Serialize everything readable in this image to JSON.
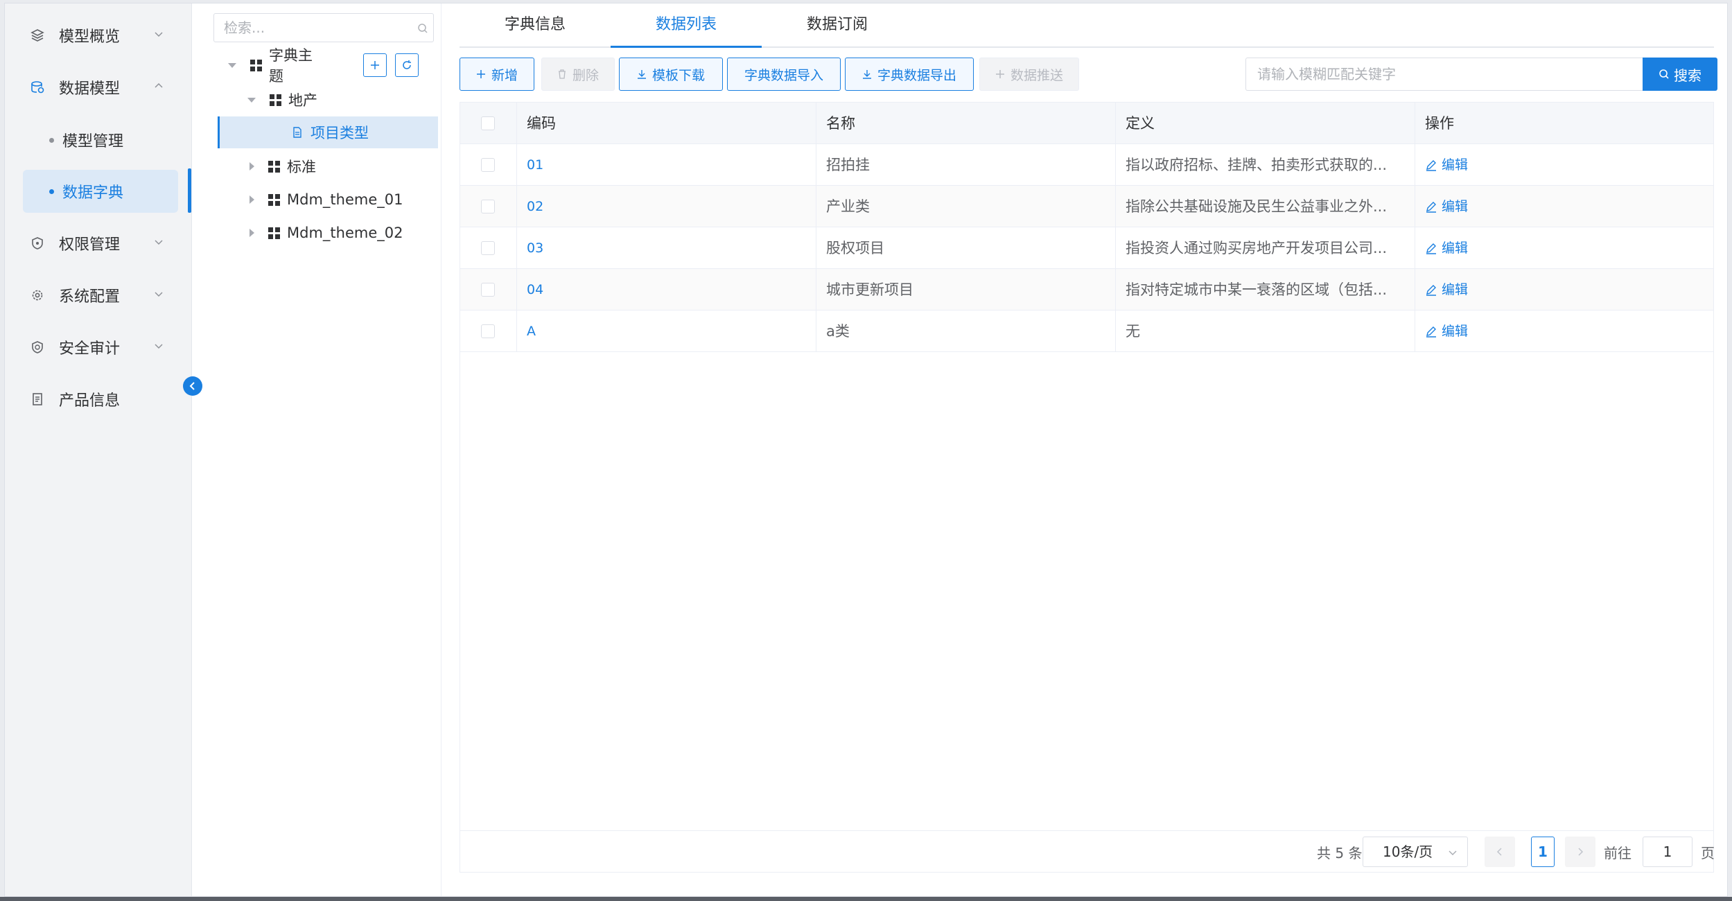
{
  "nav": {
    "items": [
      {
        "label": "模型概览",
        "icon": "layers-icon",
        "expanded": false
      },
      {
        "label": "数据模型",
        "icon": "database-icon",
        "expanded": true
      },
      {
        "label": "权限管理",
        "icon": "shield-icon",
        "expanded": false
      },
      {
        "label": "系统配置",
        "icon": "gear-icon",
        "expanded": false
      },
      {
        "label": "安全审计",
        "icon": "audit-shield-icon",
        "expanded": false
      },
      {
        "label": "产品信息",
        "icon": "document-icon"
      }
    ],
    "sub_items": [
      {
        "label": "模型管理",
        "active": false
      },
      {
        "label": "数据字典",
        "active": true
      }
    ]
  },
  "tree": {
    "search_placeholder": "检索...",
    "nodes": [
      {
        "label": "字典主题",
        "level": 0,
        "expanded": true
      },
      {
        "label": "地产",
        "level": 1,
        "expanded": true
      },
      {
        "label": "项目类型",
        "level": 2,
        "selected": true
      },
      {
        "label": "标准",
        "level": 1,
        "expanded": false
      },
      {
        "label": "Mdm_theme_01",
        "level": 1,
        "expanded": false
      },
      {
        "label": "Mdm_theme_02",
        "level": 1,
        "expanded": false
      }
    ]
  },
  "tabs": [
    {
      "label": "字典信息",
      "active": false
    },
    {
      "label": "数据列表",
      "active": true
    },
    {
      "label": "数据订阅",
      "active": false
    }
  ],
  "toolbar": {
    "add": "新增",
    "delete": "删除",
    "template_download": "模板下载",
    "import": "字典数据导入",
    "export": "字典数据导出",
    "push": "数据推送"
  },
  "search": {
    "placeholder": "请输入模糊匹配关键字",
    "button": "搜索"
  },
  "table": {
    "columns": [
      "编码",
      "名称",
      "定义",
      "操作"
    ],
    "rows": [
      {
        "code": "01",
        "name": "招拍挂",
        "definition": "指以政府招标、挂牌、拍卖形式获取的...",
        "action": "编辑"
      },
      {
        "code": "02",
        "name": "产业类",
        "definition": "指除公共基础设施及民生公益事业之外...",
        "action": "编辑"
      },
      {
        "code": "03",
        "name": "股权项目",
        "definition": "指投资人通过购买房地产开发项目公司...",
        "action": "编辑"
      },
      {
        "code": "04",
        "name": "城市更新项目",
        "definition": "指对特定城市中某一衰落的区域（包括...",
        "action": "编辑"
      },
      {
        "code": "A",
        "name": "a类",
        "definition": "无",
        "action": "编辑"
      }
    ]
  },
  "pagination": {
    "total": "共 5 条",
    "page_size": "10条/页",
    "current": "1",
    "goto_label": "前往",
    "goto_value": "1",
    "page_unit": "页"
  },
  "colors": {
    "primary": "#1a7fe0",
    "nav_bg": "#f2f3f5",
    "active_bg": "#dce9f7"
  }
}
